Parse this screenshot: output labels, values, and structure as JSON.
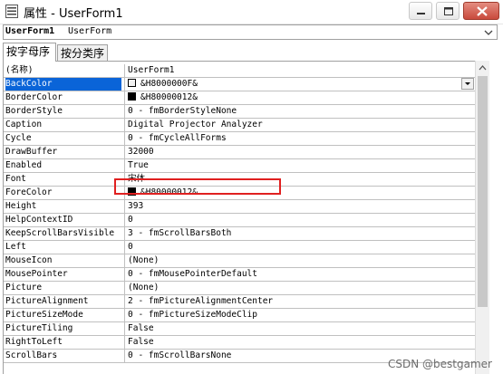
{
  "window": {
    "title": "属性 - UserForm1"
  },
  "object": {
    "name": "UserForm1",
    "type": "UserForm"
  },
  "tabs": [
    {
      "label": "按字母序"
    },
    {
      "label": "按分类序"
    }
  ],
  "properties": [
    {
      "name": "(名称)",
      "value": "UserForm1"
    },
    {
      "name": "BackColor",
      "value": "&H8000000F&",
      "swatch": "#f0f0f0"
    },
    {
      "name": "BorderColor",
      "value": "&H80000012&",
      "swatch": "#000000"
    },
    {
      "name": "BorderStyle",
      "value": "0 - fmBorderStyleNone"
    },
    {
      "name": "Caption",
      "value": "Digital Projector Analyzer"
    },
    {
      "name": "Cycle",
      "value": "0 - fmCycleAllForms"
    },
    {
      "name": "DrawBuffer",
      "value": "32000"
    },
    {
      "name": "Enabled",
      "value": "True"
    },
    {
      "name": "Font",
      "value": "宋体"
    },
    {
      "name": "ForeColor",
      "value": "&H80000012&",
      "swatch": "#000000"
    },
    {
      "name": "Height",
      "value": "393"
    },
    {
      "name": "HelpContextID",
      "value": "0"
    },
    {
      "name": "KeepScrollBarsVisible",
      "value": "3 - fmScrollBarsBoth"
    },
    {
      "name": "Left",
      "value": "0"
    },
    {
      "name": "MouseIcon",
      "value": "(None)"
    },
    {
      "name": "MousePointer",
      "value": "0 - fmMousePointerDefault"
    },
    {
      "name": "Picture",
      "value": "(None)"
    },
    {
      "name": "PictureAlignment",
      "value": "2 - fmPictureAlignmentCenter"
    },
    {
      "name": "PictureSizeMode",
      "value": "0 - fmPictureSizeModeClip"
    },
    {
      "name": "PictureTiling",
      "value": "False"
    },
    {
      "name": "RightToLeft",
      "value": "False"
    },
    {
      "name": "ScrollBars",
      "value": "0 - fmScrollBarsNone"
    }
  ],
  "selected_property": "BackColor",
  "highlight_color": "#e02020",
  "watermark": "CSDN @bestgamer"
}
